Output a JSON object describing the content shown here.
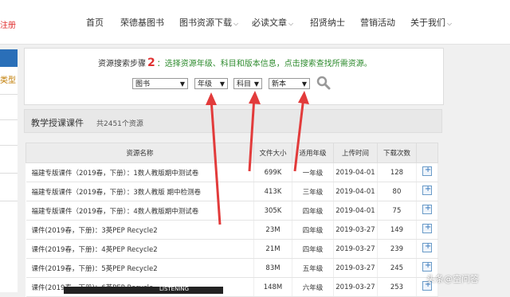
{
  "header": {
    "brand_fragment": "注册",
    "nav": [
      {
        "label": "首页",
        "dropdown": false
      },
      {
        "label": "荣德基图书",
        "dropdown": false
      },
      {
        "label": "图书资源下载",
        "dropdown": true
      },
      {
        "label": "必读文章",
        "dropdown": true
      },
      {
        "label": "招贤纳士",
        "dropdown": false
      },
      {
        "label": "营销活动",
        "dropdown": false
      },
      {
        "label": "关于我们",
        "dropdown": true
      }
    ]
  },
  "sidebar": {
    "fragment_text": "类型"
  },
  "search": {
    "step_prefix": "资源搜索步骤",
    "step_number": "2",
    "step_instruction": "：选择资源年级、科目和版本信息，点击搜索查找所需资源。",
    "selects": {
      "type": "图书",
      "grade": "年级",
      "subject": "科目",
      "version": "新本"
    }
  },
  "results": {
    "title": "教学授课课件",
    "count": "共2451个资源",
    "columns": [
      "资源名称",
      "文件大小",
      "适用年级",
      "上传时间",
      "下载次数"
    ],
    "rows": [
      {
        "name": "福建专版课件（2019春，下册）：1数人教版期中测试卷",
        "size": "699K",
        "grade": "一年级",
        "date": "2019-04-01",
        "downloads": "128"
      },
      {
        "name": "福建专版课件（2019春，下册）：3数人教版 期中检测卷",
        "size": "413K",
        "grade": "三年级",
        "date": "2019-04-01",
        "downloads": "80"
      },
      {
        "name": "福建专版课件（2019春，下册）：4数人教版期中测试卷",
        "size": "305K",
        "grade": "四年级",
        "date": "2019-04-01",
        "downloads": "75"
      },
      {
        "name": "课件(2019春，下册)：3英PEP Recycle2",
        "size": "23M",
        "grade": "四年级",
        "date": "2019-03-27",
        "downloads": "149"
      },
      {
        "name": "课件(2019春，下册)：4英PEP Recycle2",
        "size": "21M",
        "grade": "四年级",
        "date": "2019-03-27",
        "downloads": "239"
      },
      {
        "name": "课件(2019春，下册)：5英PEP Recycle2",
        "size": "83M",
        "grade": "五年级",
        "date": "2019-03-27",
        "downloads": "245"
      },
      {
        "name": "课件(2019春，下册)：6英PEP Recycle",
        "size": "148M",
        "grade": "六年级",
        "date": "2019-03-27",
        "downloads": "253"
      }
    ]
  },
  "overlay": {
    "listening": "LISTENING",
    "watermark": "头条@空问答"
  },
  "colors": {
    "accent_red": "#e03030",
    "instruction_green": "#2e8b2e",
    "sidebar_blue": "#2a6fb8",
    "arrow_red": "#e23b3b"
  }
}
